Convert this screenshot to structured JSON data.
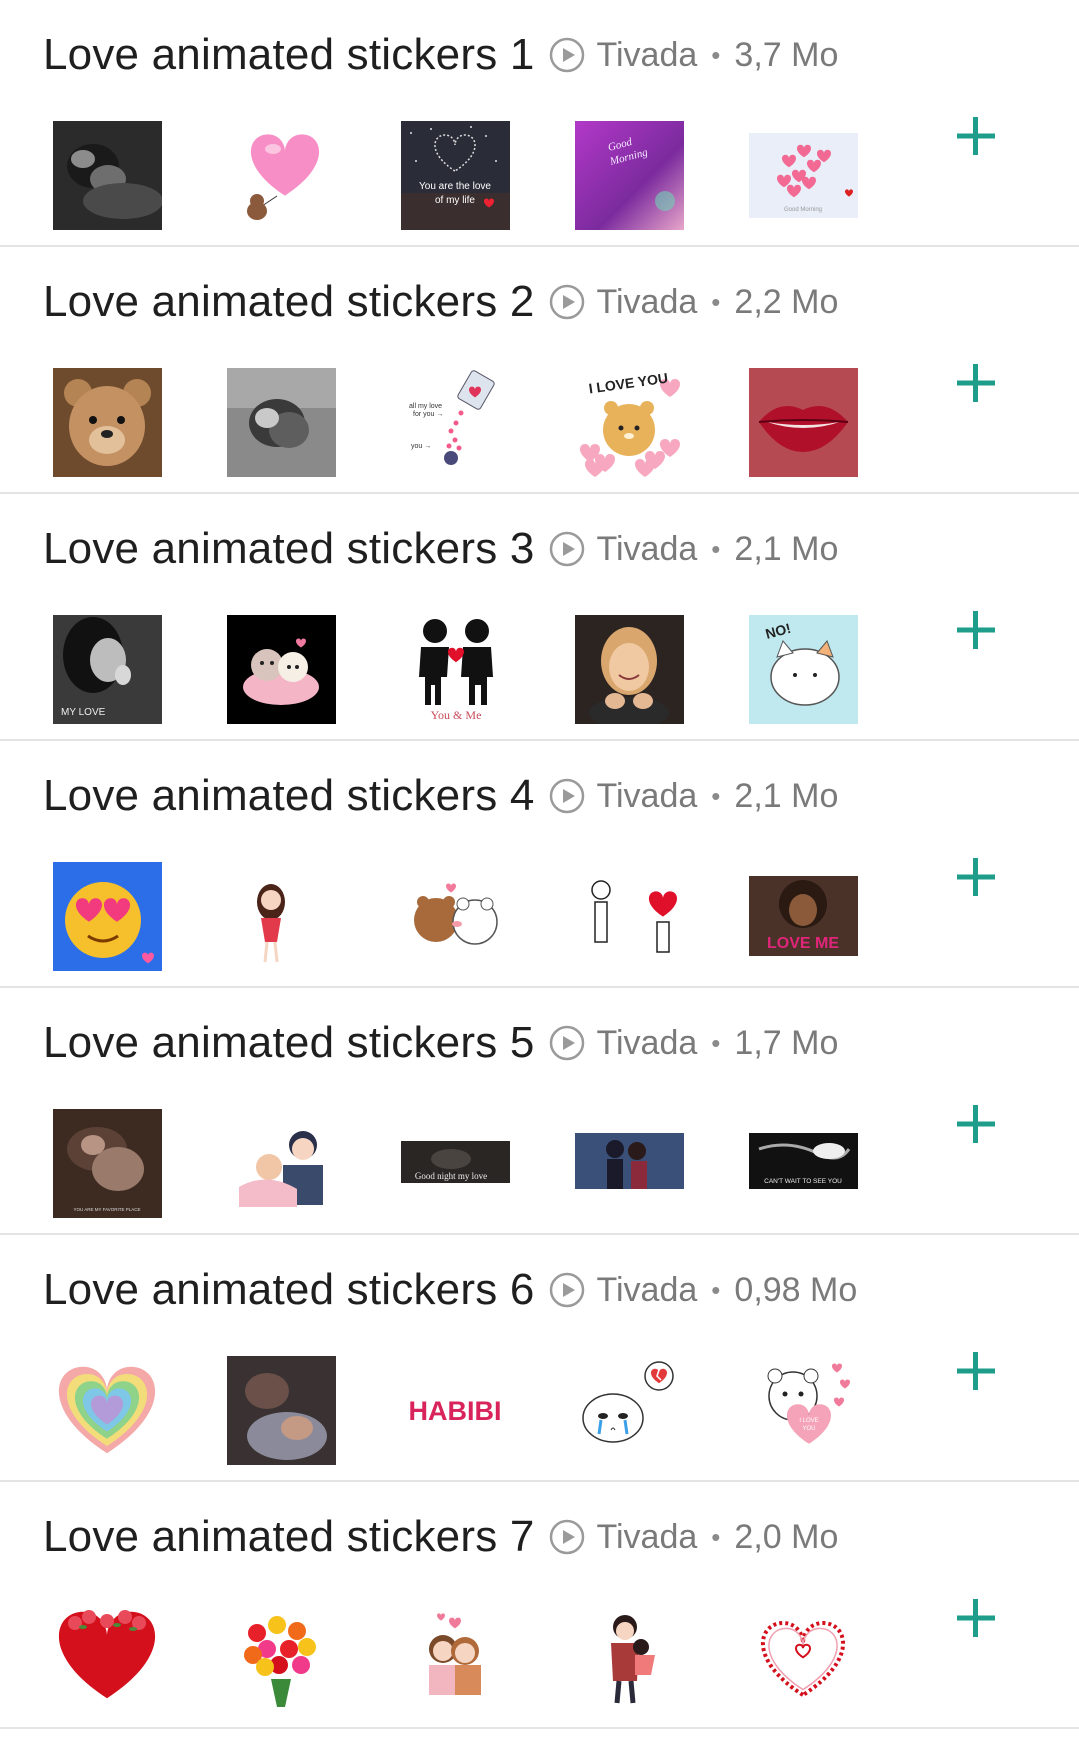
{
  "packs": [
    {
      "title": "Love animated stickers 1",
      "author": "Tivada",
      "separator": "•",
      "size": "3,7 Mo",
      "stickers": [
        "couple-bw-photo",
        "pink-heart-balloon-bear",
        "heart-night-sky-text",
        "good-morning-purple",
        "pink-butterflies-good-morning"
      ]
    },
    {
      "title": "Love animated stickers 2",
      "author": "Tivada",
      "separator": "•",
      "size": "2,2 Mo",
      "stickers": [
        "teddy-bear-photo",
        "couple-hug-bw-photo",
        "love-for-you-cup",
        "i-love-you-bear",
        "red-lips"
      ]
    },
    {
      "title": "Love animated stickers 3",
      "author": "Tivada",
      "separator": "•",
      "size": "2,1 Mo",
      "stickers": [
        "woman-kiss-bw-my-love",
        "cute-couple-bed",
        "you-and-me-figures",
        "smiling-woman-photo",
        "no-cat"
      ]
    },
    {
      "title": "Love animated stickers 4",
      "author": "Tivada",
      "separator": "•",
      "size": "2,1 Mo",
      "stickers": [
        "heart-eyes-emoji",
        "girl-cartoon",
        "bears-hug",
        "stick-figure-heart",
        "love-me-woman"
      ]
    },
    {
      "title": "Love animated stickers 5",
      "author": "Tivada",
      "separator": "•",
      "size": "1,7 Mo",
      "stickers": [
        "couple-bed-photo",
        "cartoon-couple-hug",
        "good-night-my-love",
        "couple-dance-photo",
        "cant-wait-to-see-you"
      ]
    },
    {
      "title": "Love animated stickers 6",
      "author": "Tivada",
      "separator": "•",
      "size": "0,98 Mo",
      "stickers": [
        "rainbow-heart",
        "couple-sleeping-photo",
        "habibi-text",
        "crying-heartbroken",
        "bear-i-love-you"
      ]
    },
    {
      "title": "Love animated stickers 7",
      "author": "Tivada",
      "separator": "•",
      "size": "2,0 Mo",
      "stickers": [
        "red-heart-roses",
        "flower-bouquet",
        "cartoon-couple-hearts",
        "cartoon-couple-carry",
        "floral-heart-wreath"
      ]
    }
  ],
  "sticker_texts": {
    "you_are_the_love": "You are the love of my life",
    "good_morning": "Good Morning",
    "i_love_you": "I LOVE YOU",
    "all_my_love": "all my love for you",
    "you": "you",
    "my_love": "MY LOVE",
    "you_and_me": "You & Me",
    "no": "NO!",
    "love_me": "LOVE ME",
    "favorite_place": "YOU ARE MY FAVORITE PLACE",
    "good_night": "Good night my love",
    "cant_wait": "CAN'T WAIT TO SEE YOU",
    "habibi": "HABIBI",
    "i_love_you_small": "I LOVE YOU"
  },
  "colors": {
    "accent": "#1e9e8a",
    "title": "#1f1f1f",
    "meta": "#7a7a7a",
    "divider": "#e4e4e4"
  },
  "icons": {
    "animated": "play-circle-icon",
    "add": "plus-icon"
  }
}
